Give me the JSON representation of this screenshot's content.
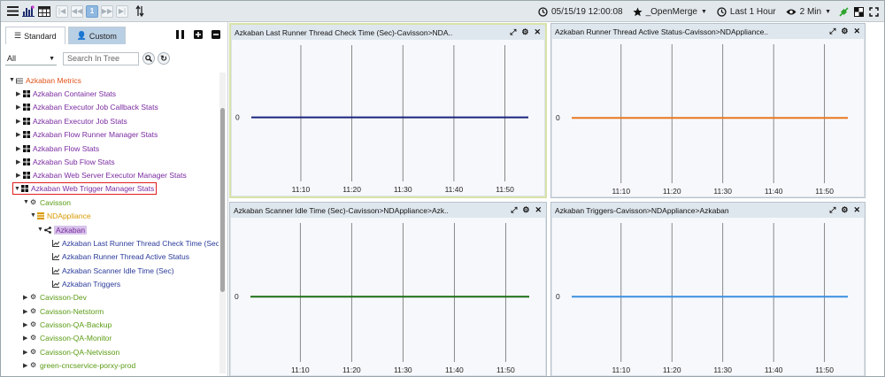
{
  "toolbar": {
    "pagination": [
      "|◀",
      "◀◀",
      "1",
      "▶▶",
      "▶|"
    ],
    "datetime": "05/15/19 12:00:08",
    "favorite": "_OpenMerge",
    "duration": "Last 1 Hour",
    "refresh": "2 Min"
  },
  "left_panel": {
    "tabs": {
      "standard": "Standard",
      "custom": "Custom"
    },
    "filter_value": "All",
    "search_placeholder": "Search In Tree",
    "tree": {
      "root": "Azkaban Metrics",
      "groups": [
        "Azkaban Container Stats",
        "Azkaban Executor Job Callback Stats",
        "Azkaban Executor Job Stats",
        "Azkaban Flow Runner Manager Stats",
        "Azkaban Flow Stats",
        "Azkaban Sub Flow Stats",
        "Azkaban Web Server Executor Manager Stats",
        "Azkaban Web Trigger Manager Stats"
      ],
      "tier": "Cavisson",
      "server": "NDAppliance",
      "instance": "Azkaban",
      "metrics": [
        "Azkaban Last Runner Thread Check Time (Sec)",
        "Azkaban Runner Thread Active Status",
        "Azkaban Scanner Idle Time (Sec)",
        "Azkaban Triggers"
      ],
      "other_tiers": [
        "Cavisson-Dev",
        "Cavisson-Netstorm",
        "Cavisson-QA-Backup",
        "Cavisson-QA-Monitor",
        "Cavisson-QA-Netvisson",
        "green-cncservice-porxy-prod"
      ]
    }
  },
  "panels": [
    {
      "title": "Azkaban Last Runner Thread Check Time (Sec)-Cavisson>NDA..",
      "color": "#1a237e"
    },
    {
      "title": "Azkaban Runner Thread Active Status-Cavisson>NDAppliance..",
      "color": "#e8781e"
    },
    {
      "title": "Azkaban Scanner Idle Time (Sec)-Cavisson>NDAppliance>Azk..",
      "color": "#1b6e16"
    },
    {
      "title": "Azkaban Triggers-Cavisson>NDAppliance>Azkaban",
      "color": "#3b8fe0"
    }
  ],
  "chart_data": [
    {
      "type": "line",
      "title": "Azkaban Last Runner Thread Check Time (Sec)-Cavisson>NDA..",
      "x_ticks": [
        "11:10",
        "11:20",
        "11:30",
        "11:40",
        "11:50"
      ],
      "y_ticks": [
        "0"
      ],
      "series": [
        {
          "values": [
            0,
            0
          ]
        }
      ]
    },
    {
      "type": "line",
      "title": "Azkaban Runner Thread Active Status-Cavisson>NDAppliance..",
      "x_ticks": [
        "11:10",
        "11:20",
        "11:30",
        "11:40",
        "11:50"
      ],
      "y_ticks": [
        "0"
      ],
      "series": [
        {
          "values": [
            0,
            0
          ]
        }
      ]
    },
    {
      "type": "line",
      "title": "Azkaban Scanner Idle Time (Sec)-Cavisson>NDAppliance>Azk..",
      "x_ticks": [
        "11:10",
        "11:20",
        "11:30",
        "11:40",
        "11:50"
      ],
      "y_ticks": [
        "0"
      ],
      "series": [
        {
          "values": [
            0,
            0
          ]
        }
      ]
    },
    {
      "type": "line",
      "title": "Azkaban Triggers-Cavisson>NDAppliance>Azkaban",
      "x_ticks": [
        "11:10",
        "11:20",
        "11:30",
        "11:40",
        "11:50"
      ],
      "y_ticks": [
        "0"
      ],
      "series": [
        {
          "values": [
            0,
            0
          ]
        }
      ]
    }
  ]
}
